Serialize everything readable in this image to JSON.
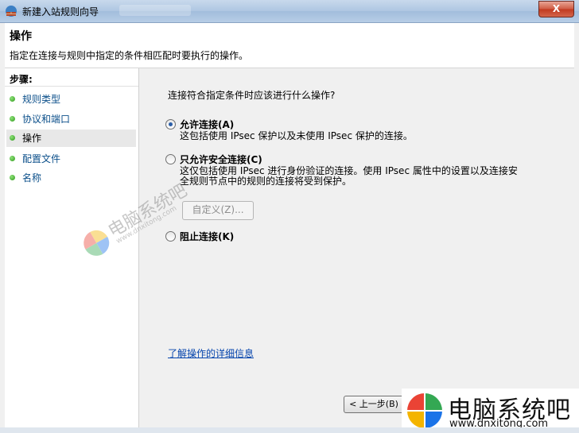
{
  "window": {
    "title": "新建入站规则向导",
    "close_label": "X"
  },
  "header": {
    "title": "操作",
    "subtitle": "指定在连接与规则中指定的条件相匹配时要执行的操作。"
  },
  "steps": {
    "title": "步骤:",
    "items": [
      {
        "label": "规则类型"
      },
      {
        "label": "协议和端口"
      },
      {
        "label": "操作"
      },
      {
        "label": "配置文件"
      },
      {
        "label": "名称"
      }
    ]
  },
  "main": {
    "question": "连接符合指定条件时应该进行什么操作?",
    "options": [
      {
        "label": "允许连接(A)",
        "desc": [
          "这包括使用 IPsec 保护以及未使用 IPsec 保护的连接。"
        ],
        "checked": true
      },
      {
        "label": "只允许安全连接(C)",
        "desc": [
          "这仅包括使用 IPsec 进行身份验证的连接。使用 IPsec 属性中的设置以及连接安",
          "全规则节点中的规则的连接将受到保护。"
        ],
        "checked": false
      },
      {
        "label": "阻止连接(K)",
        "desc": [],
        "checked": false
      }
    ],
    "custom_button": "自定义(Z)...",
    "learn_link": "了解操作的详细信息",
    "back_button": "< 上一步(B)"
  },
  "watermark": {
    "center_text": "电脑系统吧",
    "center_url": "www.dnxitong.com",
    "corner_text": "电脑系统吧",
    "corner_url": "www.dnxitong.com"
  },
  "colors": {
    "link": "#0645ad",
    "step_label": "#0b4f8a",
    "step_dot": "#2f9a1c",
    "close": "#c0391f"
  }
}
